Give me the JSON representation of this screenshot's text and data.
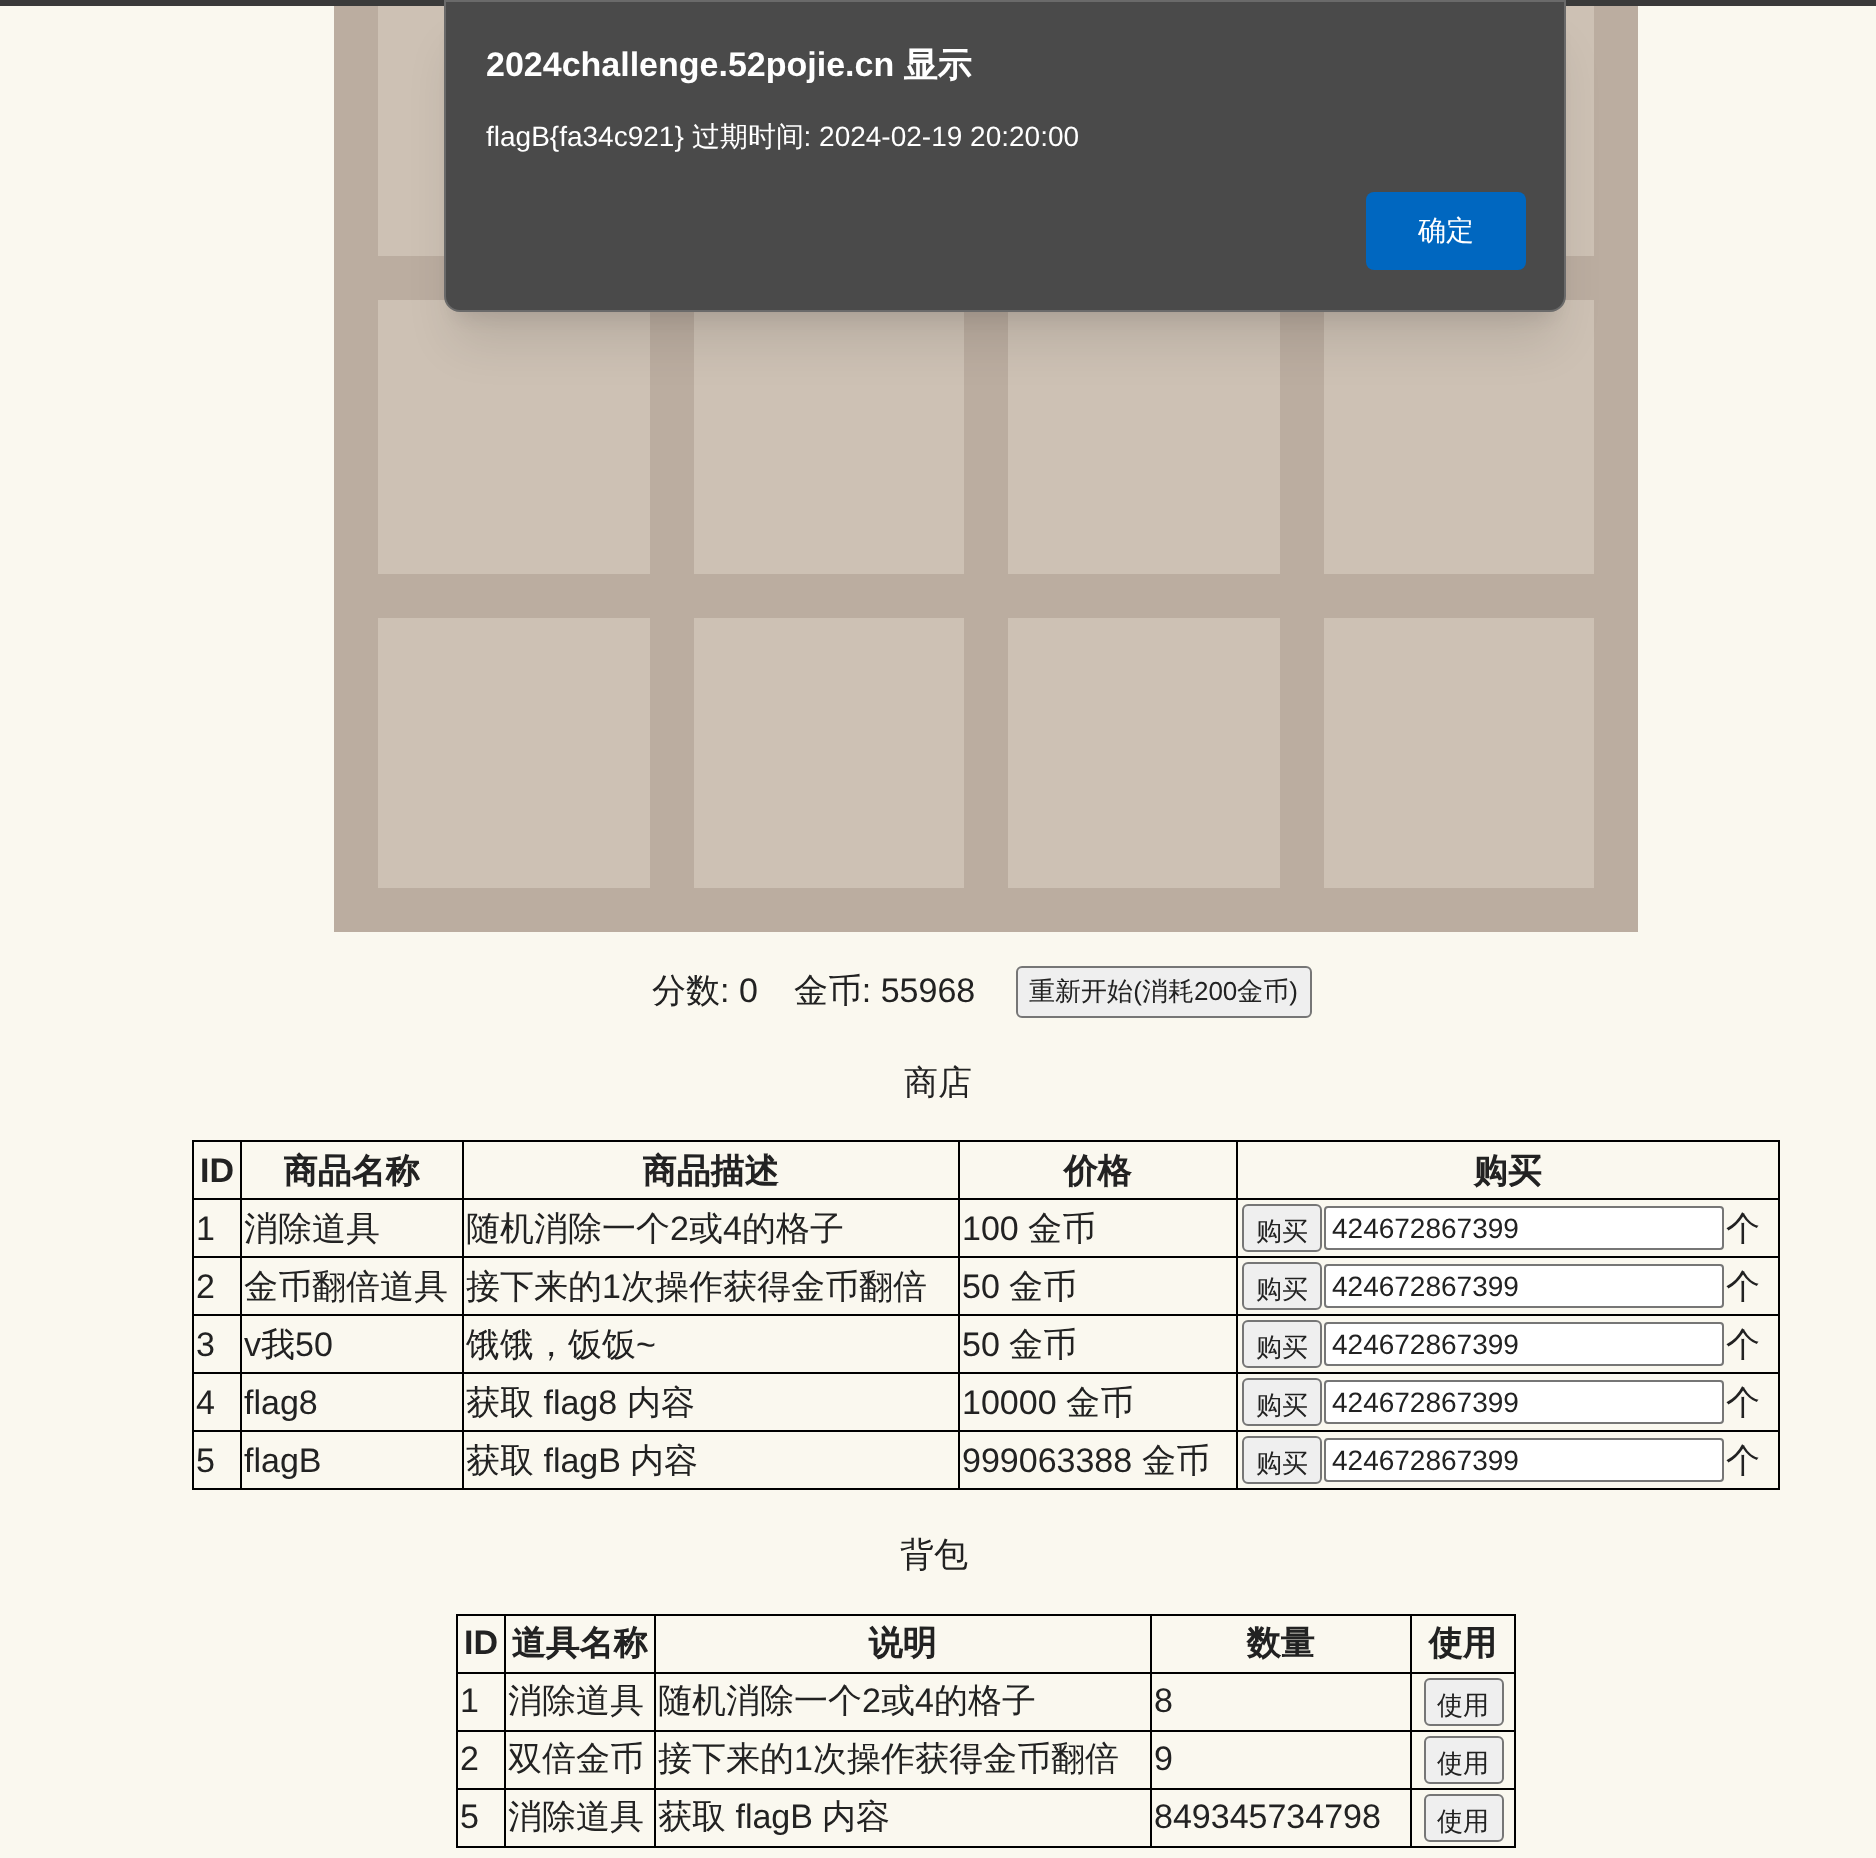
{
  "dialog": {
    "title": "2024challenge.52pojie.cn 显示",
    "message": "flagB{fa34c921} 过期时间: 2024-02-19 20:20:00",
    "button": "确定"
  },
  "status": {
    "score": "分数: 0",
    "coins": "金币: 55968",
    "restart_button": "重新开始(消耗200金币)"
  },
  "shop": {
    "title": "商店",
    "columns": [
      "ID",
      "商品名称",
      "商品描述",
      "价格",
      "购买"
    ],
    "rows": [
      {
        "id": "1",
        "name": "消除道具",
        "description": "随机消除一个2或4的格子",
        "price": "100 金币",
        "buy_button": "购买",
        "quantity": "424672867399",
        "unit": "个"
      },
      {
        "id": "2",
        "name": "金币翻倍道具",
        "description": "接下来的1次操作获得金币翻倍",
        "price": "50 金币",
        "buy_button": "购买",
        "quantity": "424672867399",
        "unit": "个"
      },
      {
        "id": "3",
        "name": "v我50",
        "description": "饿饿，饭饭~",
        "price": "50 金币",
        "buy_button": "购买",
        "quantity": "424672867399",
        "unit": "个"
      },
      {
        "id": "4",
        "name": "flag8",
        "description": "获取 flag8 内容",
        "price": "10000 金币",
        "buy_button": "购买",
        "quantity": "424672867399",
        "unit": "个"
      },
      {
        "id": "5",
        "name": "flagB",
        "description": "获取 flagB 内容",
        "price": "999063388 金币",
        "buy_button": "购买",
        "quantity": "424672867399",
        "unit": "个"
      }
    ]
  },
  "bag": {
    "title": "背包",
    "columns": [
      "ID",
      "道具名称",
      "说明",
      "数量",
      "使用"
    ],
    "rows": [
      {
        "id": "1",
        "name": "消除道具",
        "description": "随机消除一个2或4的格子",
        "count": "8",
        "use_button": "使用"
      },
      {
        "id": "2",
        "name": "双倍金币",
        "description": "接下来的1次操作获得金币翻倍",
        "count": "9",
        "use_button": "使用"
      },
      {
        "id": "5",
        "name": "消除道具",
        "description": "获取 flagB 内容",
        "count": "849345734798",
        "use_button": "使用"
      }
    ]
  }
}
